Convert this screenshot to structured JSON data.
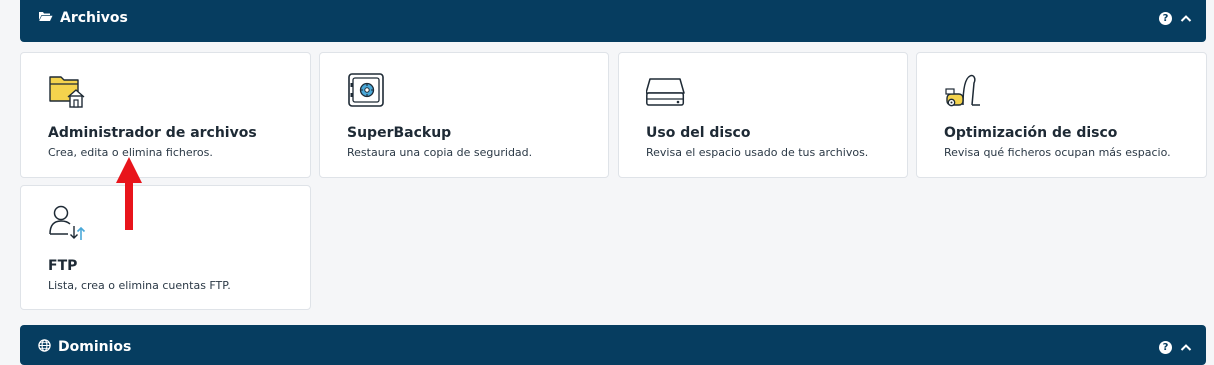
{
  "sections": {
    "archivos": {
      "title": "Archivos",
      "help_symbol": "?"
    },
    "dominios": {
      "title": "Dominios",
      "help_symbol": "?"
    }
  },
  "cards": {
    "file_manager": {
      "title": "Administrador de archivos",
      "description": "Crea, edita o elimina ficheros."
    },
    "superbackup": {
      "title": "SuperBackup",
      "description": "Restaura una copia de seguridad."
    },
    "disk_usage": {
      "title": "Uso del disco",
      "description": "Revisa el espacio usado de tus archivos."
    },
    "disk_optimization": {
      "title": "Optimización de disco",
      "description": "Revisa qué ficheros ocupan más espacio."
    },
    "ftp": {
      "title": "FTP",
      "description": "Lista, crea o elimina cuentas FTP."
    }
  },
  "icons": {
    "section_archivos": "folder-open-icon",
    "section_dominios": "globe-icon",
    "file_manager": "folder-home-icon",
    "superbackup": "safe-icon",
    "disk_usage": "hard-drive-icon",
    "disk_optimization": "vacuum-cleaner-icon",
    "ftp": "user-transfer-icon"
  },
  "colors": {
    "header_bg": "#063d60",
    "page_bg": "#f5f6f8",
    "accent_yellow": "#f4d34d",
    "accent_blue": "#4aa8d8",
    "annotation_arrow": "#e8141b"
  }
}
